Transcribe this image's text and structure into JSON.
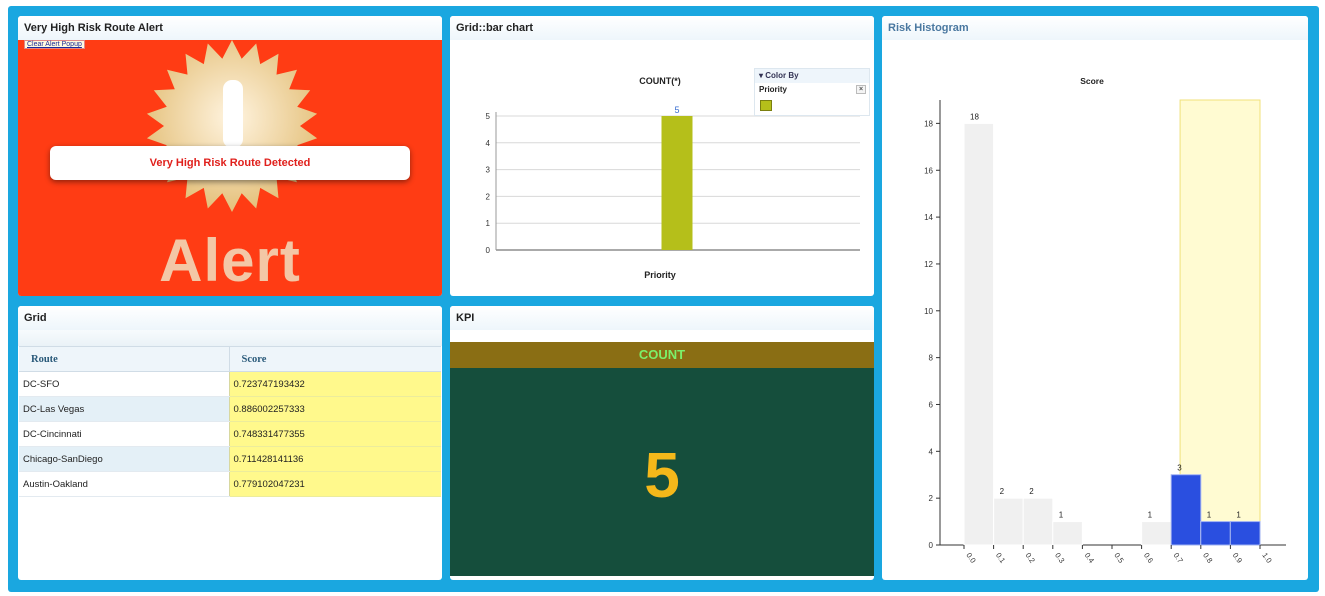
{
  "alert_panel": {
    "title": "Very High Risk Route Alert",
    "clear_link": "Clear Alert Popup",
    "alert_word": "Alert",
    "message": "Very High Risk Route Detected"
  },
  "bar_panel": {
    "title": "Grid::bar chart",
    "color_by": {
      "header": "Color By",
      "field": "Priority",
      "close": "×"
    }
  },
  "grid_panel": {
    "title": "Grid",
    "columns": [
      "Route",
      "Score"
    ],
    "rows": [
      {
        "route": "DC-SFO",
        "score": "0.723747193432"
      },
      {
        "route": "DC-Las Vegas",
        "score": "0.886002257333"
      },
      {
        "route": "DC-Cincinnati",
        "score": "0.748331477355"
      },
      {
        "route": "Chicago-SanDiego",
        "score": "0.711428141136"
      },
      {
        "route": "Austin-Oakland",
        "score": "0.779102047231"
      }
    ]
  },
  "kpi_panel": {
    "title": "KPI",
    "label": "COUNT",
    "value": "5"
  },
  "hist_panel": {
    "title": "Risk Histogram"
  },
  "colors": {
    "frame": "#1aa7e0",
    "alert_bg": "#ff3c14",
    "bar": "#b5bf1a",
    "kpi_header": "#8a6e14",
    "kpi_body": "#154e3c",
    "kpi_value": "#f4b81a",
    "hist_bar": "#f0f0f0",
    "hist_selected": "#2a4fe0",
    "hist_brush": "#fffbd2"
  },
  "chart_data": [
    {
      "type": "bar",
      "title": "COUNT(*)",
      "xlabel": "Priority",
      "ylabel": "",
      "categories": [
        ""
      ],
      "values": [
        5
      ],
      "data_labels": [
        "5"
      ],
      "ylim": [
        0,
        5
      ],
      "yticks": [
        0,
        1,
        2,
        3,
        4,
        5
      ],
      "legend": {
        "title": "Color By",
        "field": "Priority",
        "placement": "top-right"
      },
      "grid": true
    },
    {
      "type": "bar",
      "title": "Score",
      "bins": [
        0.0,
        0.1,
        0.2,
        0.3,
        0.4,
        0.5,
        0.6,
        0.7,
        0.8,
        0.9,
        1.0
      ],
      "xticks": [
        "0.0",
        "0.1",
        "0.2",
        "0.3",
        "0.4",
        "0.5",
        "0.6",
        "0.7",
        "0.8",
        "0.9",
        "1.0"
      ],
      "values": [
        18,
        2,
        2,
        1,
        0,
        0,
        1,
        3,
        1,
        1
      ],
      "data_labels": [
        "18",
        "2",
        "2",
        "1",
        "",
        "",
        "1",
        "3",
        "1",
        "1"
      ],
      "selected_values": [
        0,
        0,
        0,
        0,
        0,
        0,
        0,
        3,
        1,
        1
      ],
      "selection_range": [
        0.7,
        1.0
      ],
      "ylim": [
        0,
        19
      ],
      "yticks": [
        0,
        2,
        4,
        6,
        8,
        10,
        12,
        14,
        16,
        18
      ],
      "grid": false
    }
  ]
}
